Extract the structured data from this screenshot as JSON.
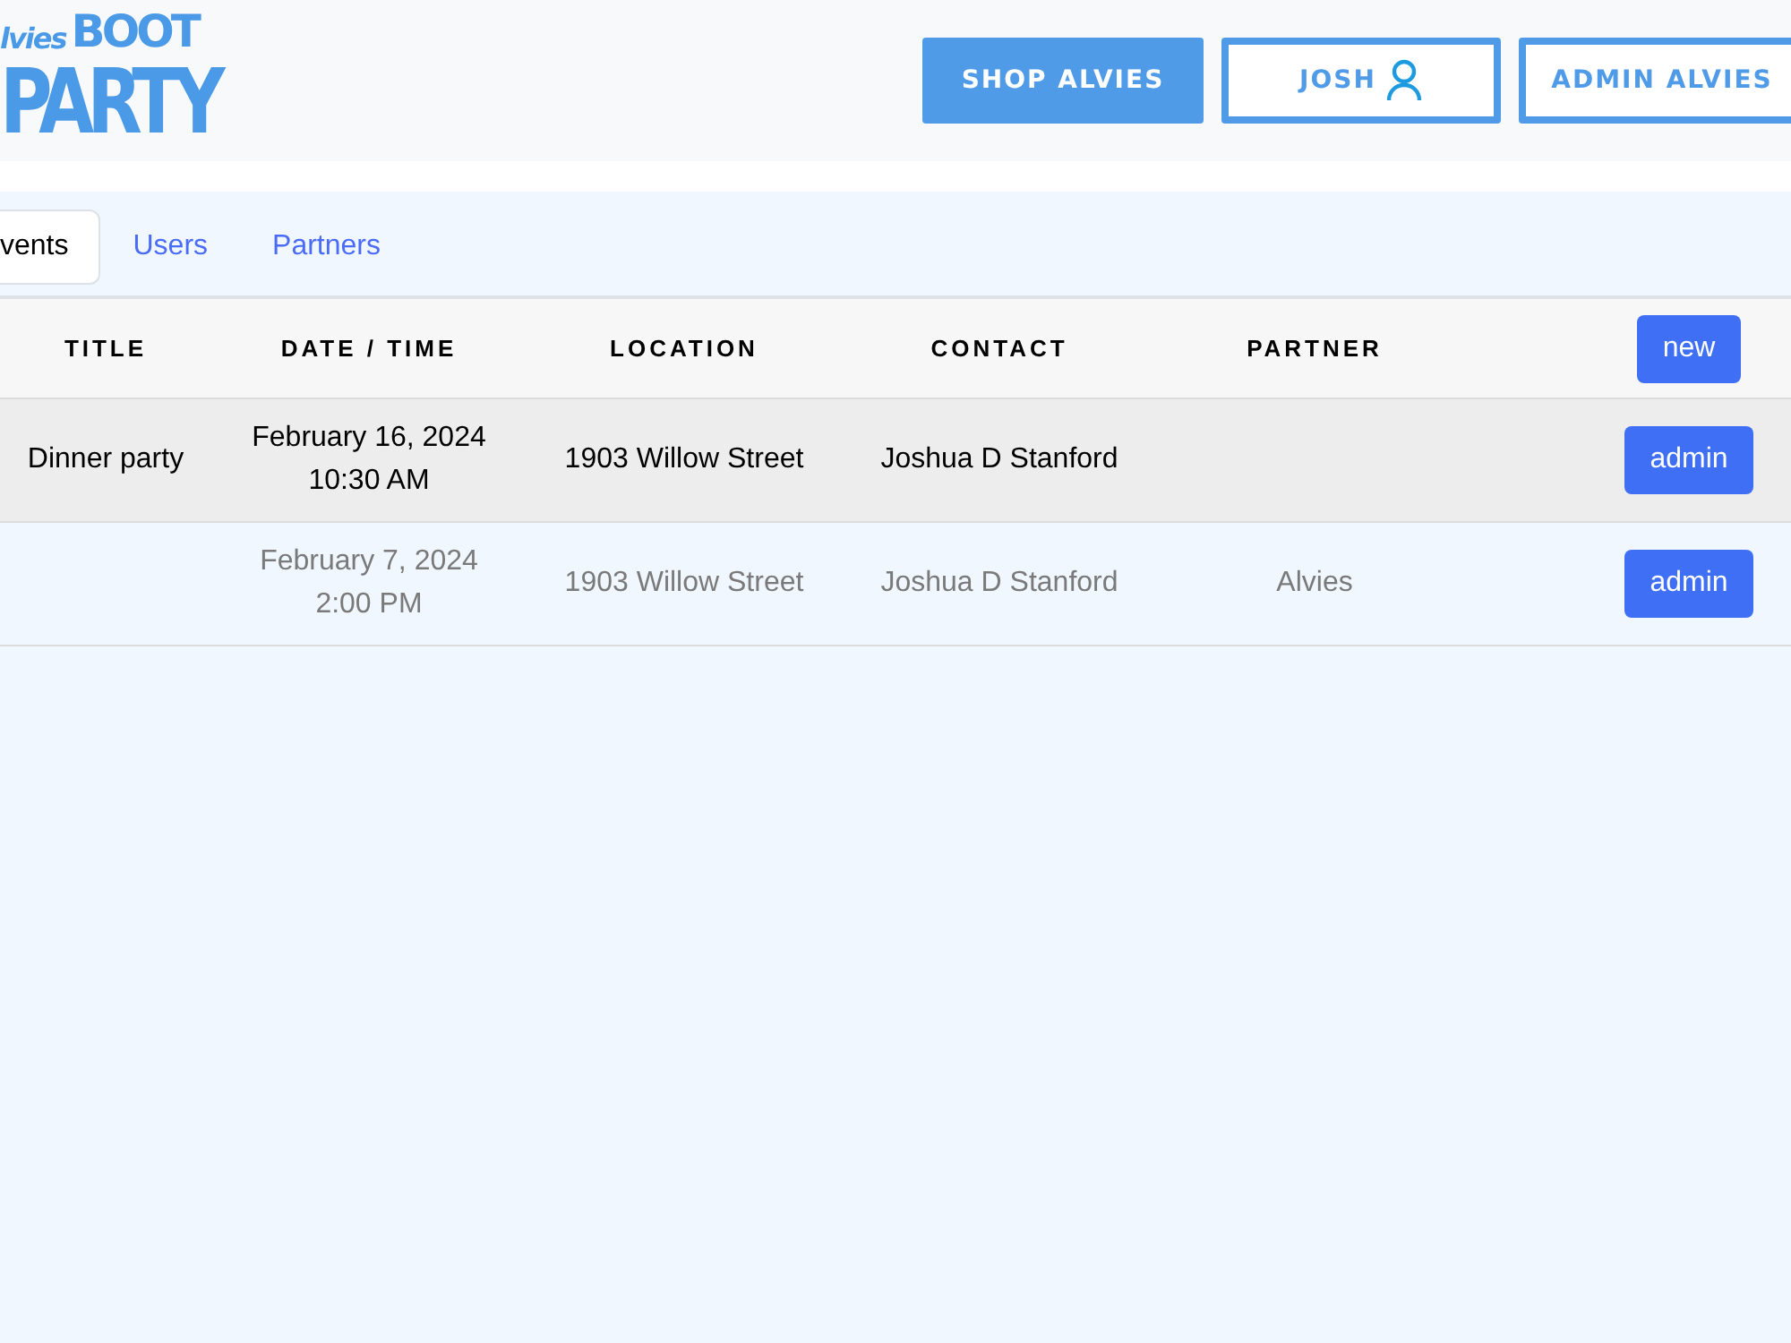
{
  "logo": {
    "script": "lvies",
    "word_1": "BOOT",
    "word_2": "PARTY"
  },
  "nav_buttons": [
    {
      "label": "SHOP ALVIES",
      "kind": "filled"
    },
    {
      "label": "JOSH",
      "kind": "user"
    },
    {
      "label": "ADMIN ALVIES",
      "kind": "outline"
    }
  ],
  "tabs": [
    {
      "label": "vents",
      "selected": true
    },
    {
      "label": "Users",
      "selected": false
    },
    {
      "label": "Partners",
      "selected": false
    }
  ],
  "table": {
    "columns": [
      "TITLE",
      "DATE / TIME",
      "LOCATION",
      "CONTACT",
      "PARTNER"
    ],
    "new_button": "new",
    "rows": [
      {
        "title": "Dinner party",
        "date": "February 16, 2024",
        "time": "10:30 AM",
        "location": "1903 Willow Street",
        "contact": "Joshua D Stanford",
        "partner": "",
        "action": "admin",
        "muted": false
      },
      {
        "title": "",
        "date": "February 7, 2024",
        "time": "2:00 PM",
        "location": "1903 Willow Street",
        "contact": "Joshua D Stanford",
        "partner": "Alvies",
        "action": "admin",
        "muted": true
      }
    ]
  }
}
